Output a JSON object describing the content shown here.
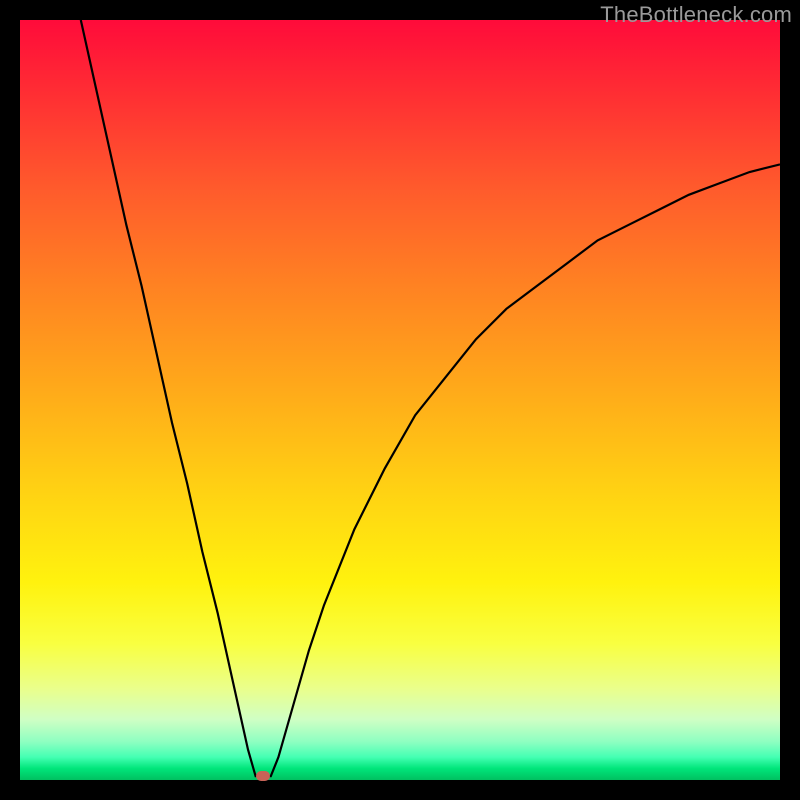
{
  "watermark": "TheBottleneck.com",
  "colors": {
    "curve_stroke": "#000000",
    "marker_fill": "#c76357",
    "frame_bg": "#000000"
  },
  "chart_data": {
    "type": "line",
    "title": "",
    "xlabel": "",
    "ylabel": "",
    "xlim": [
      0,
      100
    ],
    "ylim": [
      0,
      100
    ],
    "series": [
      {
        "name": "bottleneck-curve",
        "x": [
          8,
          10,
          12,
          14,
          16,
          18,
          20,
          22,
          24,
          26,
          28,
          30,
          31,
          32,
          33,
          34,
          36,
          38,
          40,
          44,
          48,
          52,
          56,
          60,
          64,
          68,
          72,
          76,
          80,
          84,
          88,
          92,
          96,
          100
        ],
        "y": [
          100,
          91,
          82,
          73,
          65,
          56,
          47,
          39,
          30,
          22,
          13,
          4,
          0.5,
          0.5,
          0.5,
          3,
          10,
          17,
          23,
          33,
          41,
          48,
          53,
          58,
          62,
          65,
          68,
          71,
          73,
          75,
          77,
          78.5,
          80,
          81
        ]
      }
    ],
    "annotations": [
      {
        "name": "min-marker",
        "x": 32,
        "y": 0.5
      }
    ],
    "gradient_stops": [
      {
        "pos": 0,
        "color": "#ff0b3a"
      },
      {
        "pos": 50,
        "color": "#ffd213"
      },
      {
        "pos": 100,
        "color": "#00c060"
      }
    ]
  }
}
